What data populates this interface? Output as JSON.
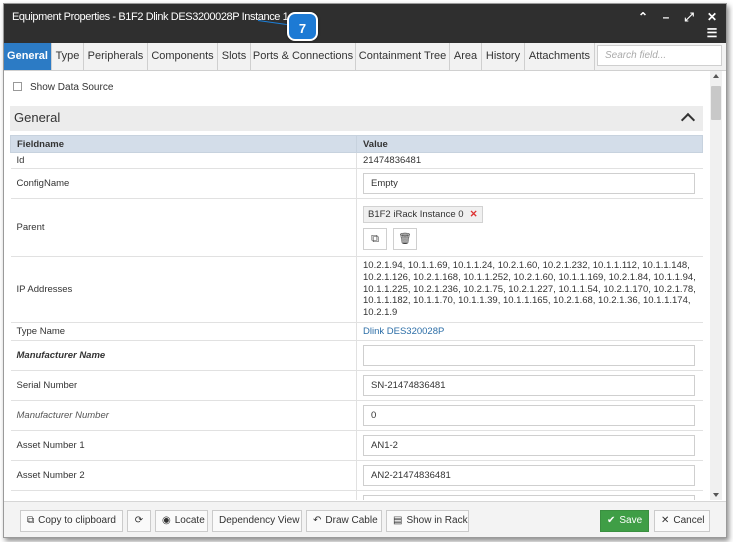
{
  "window": {
    "title": "Equipment Properties - B1F2 Dlink DES3200028P Instance 1",
    "callout_number": "7",
    "title_icons": [
      "chevron-up-icon",
      "minimize-icon",
      "expand-icon",
      "close-icon",
      "menu-icon"
    ]
  },
  "tabs": [
    {
      "label": "General",
      "active": true
    },
    {
      "label": "Type"
    },
    {
      "label": "Peripherals"
    },
    {
      "label": "Components"
    },
    {
      "label": "Slots"
    },
    {
      "label": "Ports & Connections"
    },
    {
      "label": "Containment Tree"
    },
    {
      "label": "Area"
    },
    {
      "label": "History"
    },
    {
      "label": "Attachments"
    }
  ],
  "search": {
    "placeholder": "Search field..."
  },
  "show_data_source": "Show Data Source",
  "section": {
    "title": "General"
  },
  "table": {
    "headers": {
      "field": "Fieldname",
      "value": "Value"
    },
    "rows": {
      "id": {
        "label": "Id",
        "value": "21474836481"
      },
      "configname": {
        "label": "ConfigName",
        "value": "Empty"
      },
      "parent": {
        "label": "Parent",
        "chip": "B1F2 iRack Instance 0"
      },
      "ip": {
        "label": "IP Addresses",
        "value": "10.2.1.94, 10.1.1.69, 10.1.1.24, 10.2.1.60, 10.2.1.232, 10.1.1.112, 10.1.1.148, 10.2.1.126, 10.2.1.168, 10.1.1.252, 10.2.1.60, 10.1.1.169, 10.2.1.84, 10.1.1.94, 10.1.1.225, 10.2.1.236, 10.2.1.75, 10.2.1.227, 10.1.1.54, 10.2.1.170, 10.2.1.78, 10.1.1.182, 10.1.1.70, 10.1.1.39, 10.1.1.165, 10.2.1.68, 10.2.1.36, 10.1.1.174, 10.2.1.9"
      },
      "typename": {
        "label": "Type Name",
        "value": "Dlink DES320028P"
      },
      "manufacturer": {
        "label": "Manufacturer Name",
        "value": ""
      },
      "serial": {
        "label": "Serial Number",
        "value": "SN-21474836481"
      },
      "mfr_number": {
        "label": "Manufacturer Number",
        "value": "0"
      },
      "asset1": {
        "label": "Asset Number 1",
        "value": "AN1-2"
      },
      "asset2": {
        "label": "Asset Number 2",
        "value": "AN2-21474836481"
      }
    }
  },
  "footer": {
    "copy": "Copy to clipboard",
    "locate": "Locate",
    "dependency": "Dependency View",
    "draw_cable": "Draw Cable",
    "show_in_rack": "Show in Rack",
    "save": "Save",
    "cancel": "Cancel"
  },
  "colors": {
    "titlebar": "#2f2f2f",
    "active_tab": "#2c7bc5",
    "header_row": "#d3dde9",
    "save": "#3f9e46",
    "link": "#2c6ea7",
    "callout": "#1d7ad4"
  }
}
